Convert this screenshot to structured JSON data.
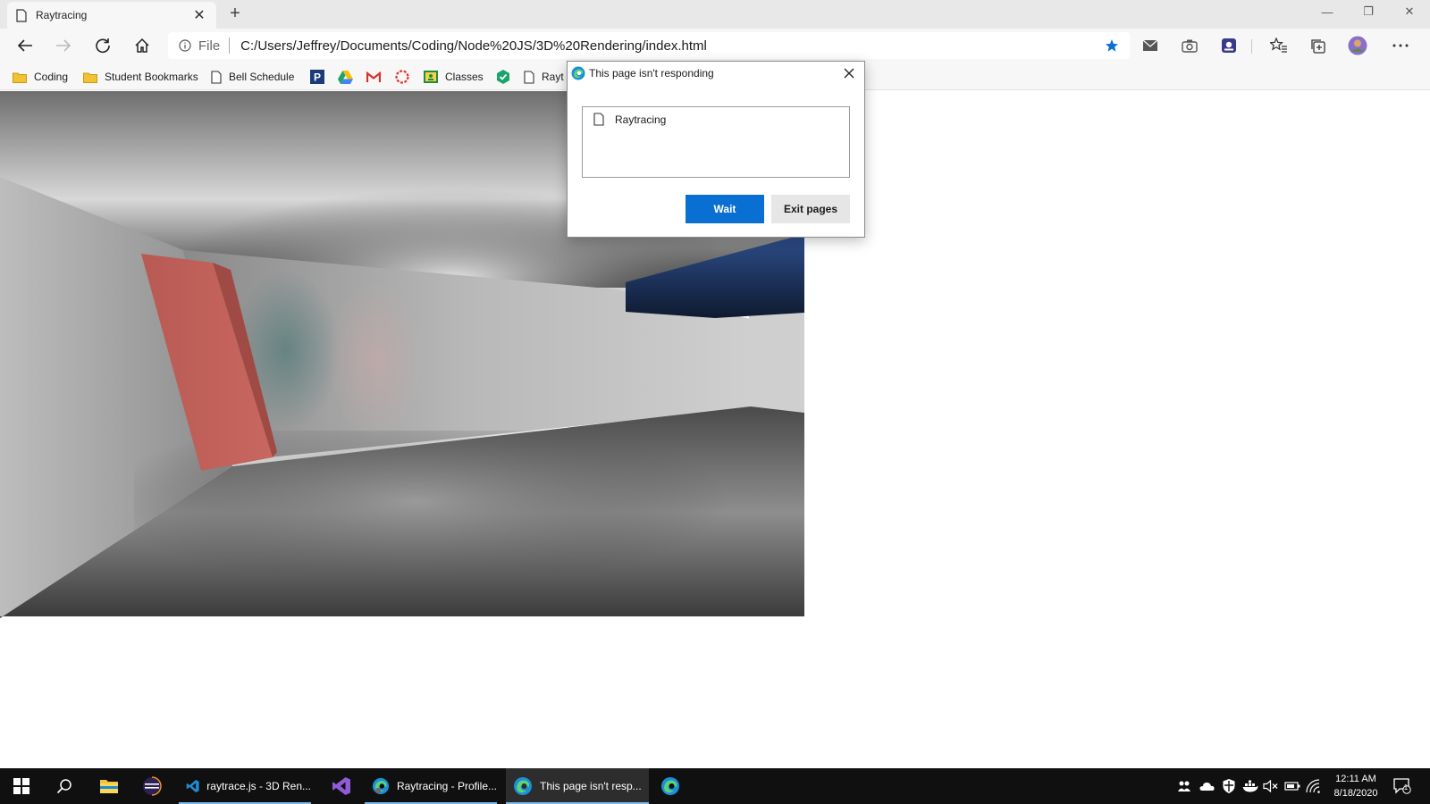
{
  "browser": {
    "tab_title": "Raytracing",
    "tab_close": "✕",
    "new_tab": "+",
    "window_controls": [
      "—",
      "❐",
      "✕"
    ],
    "address": {
      "scheme_label": "File",
      "url": "C:/Users/Jeffrey/Documents/Coding/Node%20JS/3D%20Rendering/index.html"
    },
    "favorites": [
      {
        "label": "Coding",
        "icon": "folder-icon"
      },
      {
        "label": "Student Bookmarks",
        "icon": "folder-icon"
      },
      {
        "label": "Bell Schedule",
        "icon": "page-icon"
      },
      {
        "label": "",
        "icon": "p-logo-icon"
      },
      {
        "label": "",
        "icon": "drive-icon"
      },
      {
        "label": "",
        "icon": "gmail-icon"
      },
      {
        "label": "",
        "icon": "ring-icon"
      },
      {
        "label": "Classes",
        "icon": "classroom-icon"
      },
      {
        "label": "",
        "icon": "shield-app-icon"
      },
      {
        "label": "Rayt",
        "icon": "page-icon"
      }
    ]
  },
  "dialog": {
    "title": "This page isn't responding",
    "page_item": "Raytracing",
    "wait_label": "Wait",
    "exit_label": "Exit pages"
  },
  "taskbar": {
    "apps": [
      {
        "label": "raytrace.js - 3D Ren...",
        "icon": "vscode-icon"
      },
      {
        "label": "Raytracing - Profile...",
        "icon": "edge-icon"
      },
      {
        "label": "This page isn't resp...",
        "icon": "edge-icon"
      }
    ],
    "clock": {
      "time": "12:11 AM",
      "date": "8/18/2020"
    },
    "notification_count": "1"
  },
  "colors": {
    "accent": "#0a6fd2",
    "taskbar": "#101010",
    "red_box": "#c25a52",
    "blue_box": "#2f4a80"
  }
}
